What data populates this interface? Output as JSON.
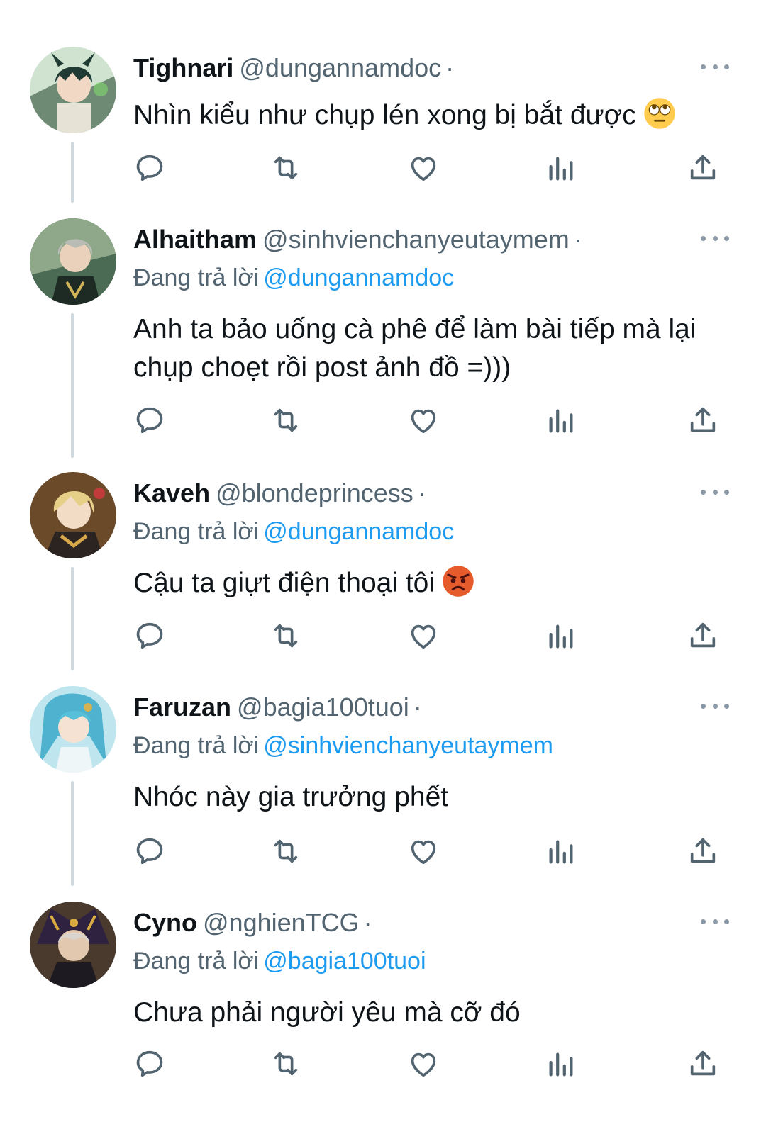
{
  "reply_prefix": "Đang trả lời",
  "colors": {
    "text": "#0f1419",
    "secondary": "#536471",
    "link": "#1d9bf0",
    "icon": "#536471",
    "thread_line": "#cfd9de"
  },
  "action_icons": [
    "reply-icon",
    "retweet-icon",
    "like-icon",
    "views-icon",
    "share-icon"
  ],
  "tweets": [
    {
      "name": "Tighnari",
      "handle": "@dungannamdoc",
      "separator": "·",
      "reply_to": null,
      "text": "Nhìn kiểu như chụp lén xong bị bắt được",
      "emoji": "face-with-rolling-eyes-emoji"
    },
    {
      "name": "Alhaitham",
      "handle": "@sinhvienchanyeutaymem",
      "separator": "·",
      "reply_to": "@dungannamdoc",
      "text_lines": [
        "Anh ta bảo uống cà phê để làm bài tiếp mà lại",
        "chụp choẹt rồi post ảnh đồ =)))"
      ]
    },
    {
      "name": "Kaveh",
      "handle": "@blondeprincess",
      "separator": "·",
      "reply_to": "@dungannamdoc",
      "text": "Cậu ta giựt điện thoại tôi",
      "emoji": "angry-face-emoji"
    },
    {
      "name": "Faruzan",
      "handle": "@bagia100tuoi",
      "separator": "·",
      "reply_to": "@sinhvienchanyeutaymem",
      "text": "Nhóc này gia trưởng phết"
    },
    {
      "name": "Cyno",
      "handle": "@nghienTCG",
      "separator": "·",
      "reply_to": "@bagia100tuoi",
      "text": "Chưa phải người yêu mà cỡ đó"
    }
  ]
}
